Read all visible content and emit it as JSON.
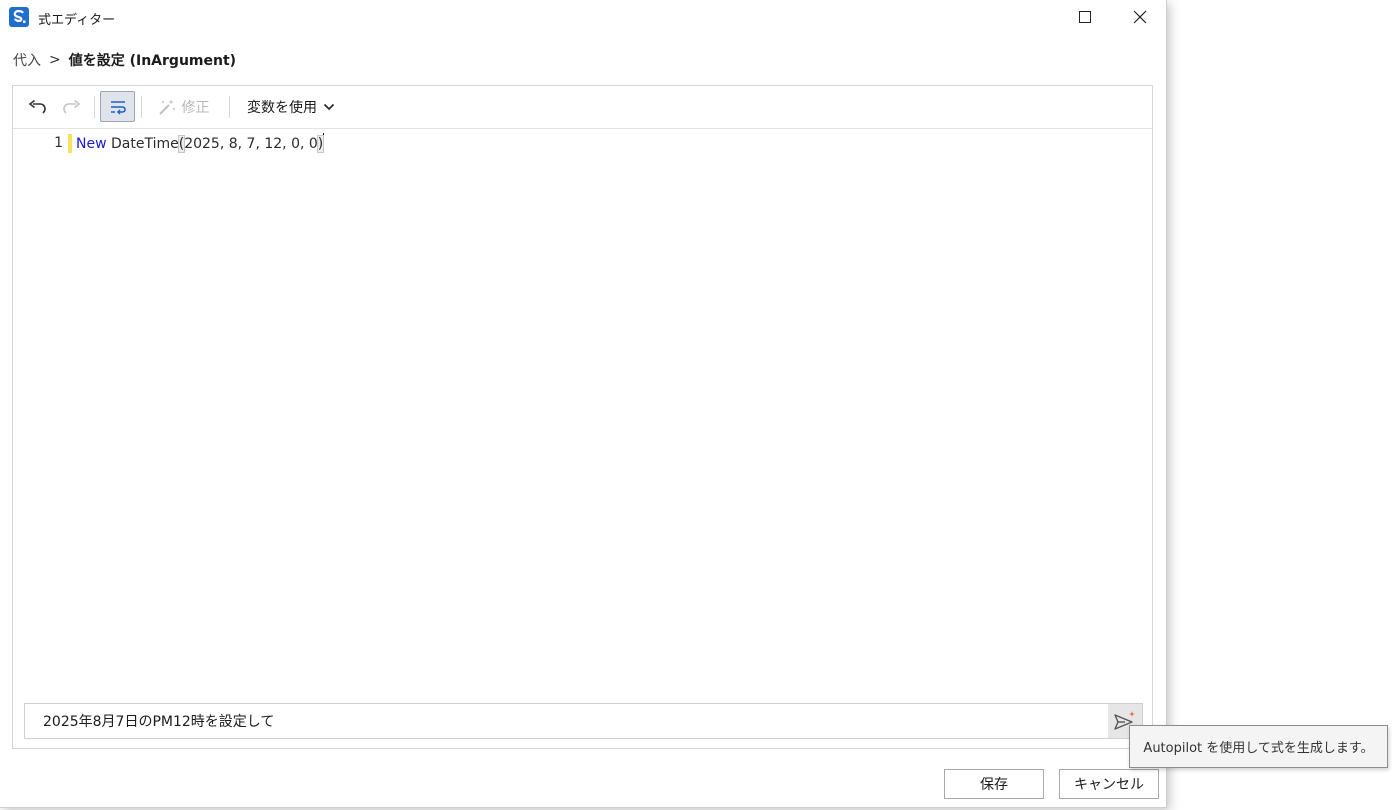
{
  "window": {
    "title": "式エディター"
  },
  "breadcrumb": {
    "parent": "代入",
    "separator": ">",
    "current": "値を設定 (InArgument)"
  },
  "toolbar": {
    "undo_icon": "undo-icon",
    "redo_icon": "redo-icon",
    "wrap_icon": "word-wrap-icon",
    "fix_label": "修正",
    "fix_icon": "magic-wand-icon",
    "variables_label": "変数を使用",
    "variables_icon": "chevron-down-icon"
  },
  "editor": {
    "lines": [
      {
        "number": "1",
        "keyword": "New",
        "identifier": " DateTime",
        "open_paren": "(",
        "args": "2025, 8, 7, 12, 0, 0",
        "close_paren": ")"
      }
    ]
  },
  "autopilot": {
    "prompt_value": "2025年8月7日のPM12時を設定して",
    "send_icon": "send-sparkle-icon",
    "tooltip": "Autopilot を使用して式を生成します。"
  },
  "footer": {
    "save_label": "保存",
    "cancel_label": "キャンセル"
  },
  "colors": {
    "keyword": "#1a1ad6",
    "line_marker": "#f6e05e",
    "app_icon": "#1f6fd1",
    "sparkle": "#e8552e"
  }
}
